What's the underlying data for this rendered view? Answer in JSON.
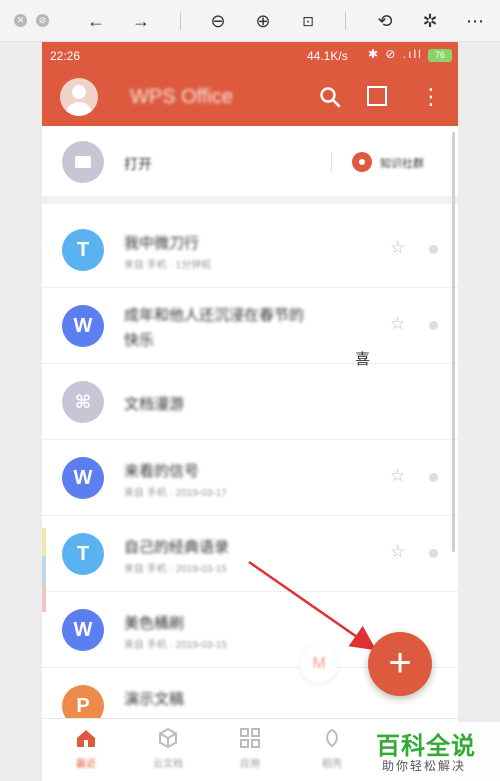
{
  "status_bar": {
    "time": "22:26",
    "network_speed": "44.1K/s",
    "icons": "✱ ⊘ .ıll ≋",
    "battery": "76"
  },
  "app_bar": {
    "title": "WPS Office",
    "search_icon": "search-icon",
    "window_icon": "window-icon",
    "more_icon": "⋮"
  },
  "open_row": {
    "label": "打开",
    "knowledge_label": "知识社群"
  },
  "documents": [
    {
      "type": "T",
      "color": "#5ab2f0",
      "title": "我中微刀行",
      "meta": "来自 手机 · 1分钟前"
    },
    {
      "type": "W",
      "color": "#5b7ff0",
      "title": "成年和他人还沉浸在春节的",
      "title_line2": "快乐",
      "meta": ""
    },
    {
      "type": "satellite",
      "color": "#c6c6d6",
      "title": "文档漫游",
      "meta": ""
    },
    {
      "type": "W",
      "color": "#5b7ff0",
      "title": "来看的信号",
      "meta": "来自 手机 · 2019-03-17"
    },
    {
      "type": "T",
      "color": "#5ab2f0",
      "title": "自己的经典语录",
      "meta": "来自 手机 · 2019-03-15"
    },
    {
      "type": "W",
      "color": "#5b7ff0",
      "title": "美色桶刷",
      "meta": "来自 手机 · 2019-03-15"
    },
    {
      "type": "P",
      "color": "#ee8a4a",
      "title": "演示文稿",
      "meta": ""
    }
  ],
  "clear_char": "喜",
  "fab": {
    "label": "+"
  },
  "mini_fab": {
    "label": "M"
  },
  "nav": [
    {
      "label": "最近",
      "icon": "home-icon",
      "active": true
    },
    {
      "label": "云文档",
      "icon": "cloud-box-icon",
      "active": false
    },
    {
      "label": "应用",
      "icon": "grid-icon",
      "active": false
    },
    {
      "label": "稻壳",
      "icon": "shell-icon",
      "active": false
    }
  ],
  "watermark": {
    "big": "百科全说",
    "small": "助你轻松解决"
  },
  "colors": {
    "accent": "#dd5a3e",
    "blue_doc": "#5ab2f0",
    "word_doc": "#5b7ff0",
    "ppt_doc": "#ee8a4a",
    "watermark_green": "#33aa33"
  }
}
